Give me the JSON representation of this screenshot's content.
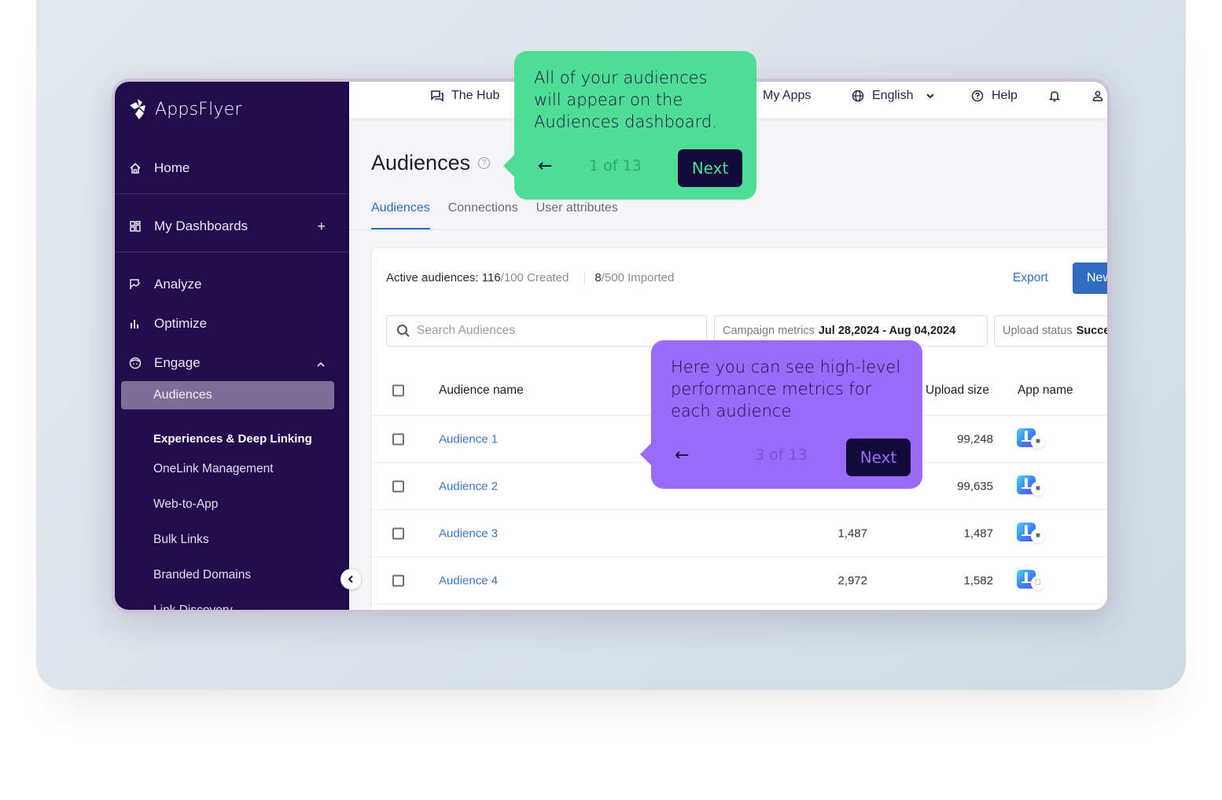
{
  "sidebar": {
    "brand": "AppsFlyer",
    "items": [
      {
        "label": "Home",
        "icon": "home-icon"
      },
      {
        "label": "My Dashboards",
        "icon": "dashboard-icon",
        "action": "+"
      },
      {
        "label": "Analyze",
        "icon": "analyze-icon"
      },
      {
        "label": "Optimize",
        "icon": "bar-chart-icon"
      },
      {
        "label": "Engage",
        "icon": "engage-icon",
        "expanded": true
      }
    ],
    "engage_sub": {
      "active": "Audiences",
      "section_heading": "Experiences & Deep Linking",
      "links": [
        "OneLink Management",
        "Web-to-App",
        "Bulk Links",
        "Branded Domains",
        "Link Discovery"
      ]
    }
  },
  "topbar": {
    "hub": "The Hub",
    "my_apps": "My Apps",
    "language": "English",
    "help": "Help"
  },
  "page": {
    "title": "Audiences",
    "tabs": [
      "Audiences",
      "Connections",
      "User attributes"
    ],
    "active_tab": "Audiences"
  },
  "summary": {
    "label": "Active audiences:",
    "created_count": "116",
    "created_limit": "/100 Created",
    "imported_count": "8",
    "imported_limit": "/500 Imported"
  },
  "actions": {
    "export": "Export",
    "new": "New"
  },
  "search": {
    "placeholder": "Search Audiences",
    "value": ""
  },
  "filters": {
    "campaign_label": "Campaign metrics",
    "campaign_value": "Jul 28,2024 - Aug 04,2024",
    "upload_label": "Upload status",
    "upload_value": "Success"
  },
  "table": {
    "columns": [
      "Audience name",
      "",
      "Upload size",
      "App name"
    ],
    "rows": [
      {
        "name": "Audience 1",
        "size": "",
        "upload_size": "99,248",
        "os": "android"
      },
      {
        "name": "Audience 2",
        "size": "",
        "upload_size": "99,635",
        "os": "android"
      },
      {
        "name": "Audience 3",
        "size": "1,487",
        "upload_size": "1,487",
        "os": "android"
      },
      {
        "name": "Audience 4",
        "size": "2,972",
        "upload_size": "1,582",
        "os": "apple"
      }
    ]
  },
  "tooltips": [
    {
      "text": "All of your audiences will appear on the Audiences dashboard.",
      "counter": "1 of 13",
      "next": "Next",
      "color": "#4fdc95"
    },
    {
      "text": "Here you can see high-level performance metrics for each audience",
      "counter": "3 of 13",
      "next": "Next",
      "color": "#9a6bfb"
    }
  ],
  "colors": {
    "sidebar_bg": "#210c4e",
    "accent_blue": "#2f6cc2",
    "tip_green": "#4fdc95",
    "tip_purple": "#9a6bfb"
  }
}
